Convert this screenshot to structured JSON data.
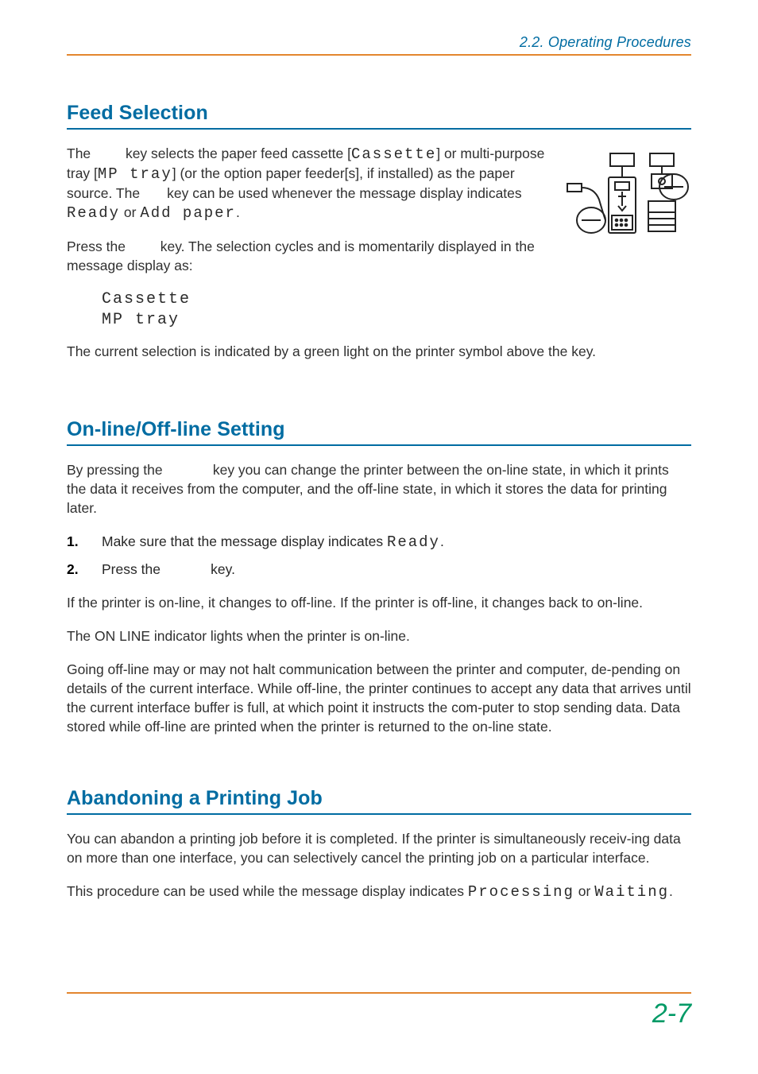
{
  "header": {
    "running_head": "2.2.  Operating Procedures"
  },
  "sections": {
    "feed": {
      "title": "Feed Selection",
      "p1a": "The ",
      "p1b": " key selects the paper feed cassette [",
      "p1_lcd1": "Cassette",
      "p1c": "] or multi‑purpose tray [",
      "p1_lcd2": "MP tray",
      "p1d": "] (or the option paper feeder[s], if installed) as the paper source. The ",
      "p1e": " key can be used whenever the message display indicates ",
      "p1_lcd3": "Ready",
      "p1f": " or ",
      "p1_lcd4": "Add paper",
      "p1g": ".",
      "p2a": "Press the ",
      "p2b": " key. The selection cycles and is momentarily displayed in the message display as:",
      "block1": "Cassette",
      "block2": "MP tray",
      "p3": "The current selection is indicated by a green light on the printer symbol above the key."
    },
    "online": {
      "title": "On-line/Off-line Setting",
      "p1a": "By pressing the ",
      "p1b": " key you can change the printer between the on-line state, in which it prints the data it receives from the computer, and the off-line state, in which it stores the data for printing later.",
      "step1a": "Make sure that the message display indicates ",
      "step1_lcd": "Ready",
      "step1b": ".",
      "step2a": "Press the ",
      "step2b": " key.",
      "p2": "If the printer is on-line, it changes to off-line. If the printer is off-line, it changes back to on‑line.",
      "p3": "The ON LINE indicator lights when the printer is on-line.",
      "p4": "Going off-line may or may not halt communication between the printer and computer, de‑pending on details of the current interface. While off-line, the printer continues to accept any data that arrives until the current interface buffer is full, at which point it instructs the com‑puter to stop sending data. Data stored while off-line are printed when the printer is returned to the on-line state."
    },
    "abandon": {
      "title": "Abandoning a Printing Job",
      "p1": "You can abandon a printing job before it is completed. If the printer is simultaneously receiv‑ing data on more than one interface, you can selectively cancel the printing job on a particular interface.",
      "p2a": "This procedure can be used while the message display indicates ",
      "p2_lcd1": "Processing",
      "p2b": " or ",
      "p2_lcd2": "Waiting",
      "p2c": "."
    }
  },
  "footer": {
    "folio": "2-7"
  },
  "icons": {
    "panel": "printer-panel-illustration"
  }
}
